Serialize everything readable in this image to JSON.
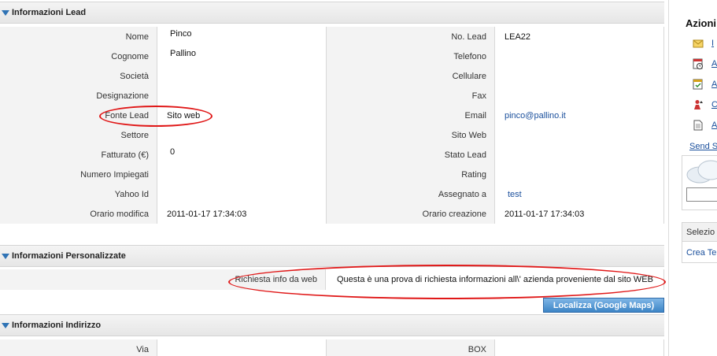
{
  "lead_section": {
    "title": "Informazioni Lead",
    "rows": [
      {
        "label_left": "Nome",
        "value_left": "Pinco",
        "label_right": "No. Lead",
        "value_right": "LEA22"
      },
      {
        "label_left": "Cognome",
        "value_left": "Pallino",
        "label_right": "Telefono",
        "value_right": ""
      },
      {
        "label_left": "Società",
        "value_left": "",
        "label_right": "Cellulare",
        "value_right": ""
      },
      {
        "label_left": "Designazione",
        "value_left": "",
        "label_right": "Fax",
        "value_right": ""
      },
      {
        "label_left": "Fonte Lead",
        "value_left": "Sito web",
        "label_right": "Email",
        "value_right": "pinco@pallino.it"
      },
      {
        "label_left": "Settore",
        "value_left": "",
        "label_right": "Sito Web",
        "value_right": ""
      },
      {
        "label_left": "Fatturato (€)",
        "value_left": "0",
        "label_right": "Stato Lead",
        "value_right": ""
      },
      {
        "label_left": "Numero Impiegati",
        "value_left": "",
        "label_right": "Rating",
        "value_right": ""
      },
      {
        "label_left": "Yahoo Id",
        "value_left": "",
        "label_right": "Assegnato a",
        "value_right": "test"
      },
      {
        "label_left": "Orario modifica",
        "value_left": "2011-01-17 17:34:03",
        "label_right": "Orario creazione",
        "value_right": "2011-01-17 17:34:03"
      }
    ]
  },
  "custom_section": {
    "title": "Informazioni Personalizzate",
    "label": "Richiesta info da web",
    "value": "Questa è una prova di richiesta informazioni all\\' azienda proveniente dal sito WEB"
  },
  "maps_button": "Localizza (Google Maps)",
  "address_section": {
    "title": "Informazioni Indirizzo",
    "label_left": "Via",
    "value_left": "",
    "label_right": "BOX",
    "value_right": ""
  },
  "sidebar": {
    "title": "Azioni",
    "items": [
      {
        "icon": "envelope-icon",
        "label": "I"
      },
      {
        "icon": "calendar-clock-icon",
        "label": "A"
      },
      {
        "icon": "calendar-check-icon",
        "label": "A"
      },
      {
        "icon": "convert-user-icon",
        "label": "C"
      },
      {
        "icon": "document-icon",
        "label": "A"
      }
    ],
    "send_link": "Send S",
    "select_header": "Selezio",
    "create_link": "Crea Te"
  },
  "colors": {
    "annotation": "#e01818",
    "link": "#1a4f9c",
    "accent": "#2f73b5"
  }
}
